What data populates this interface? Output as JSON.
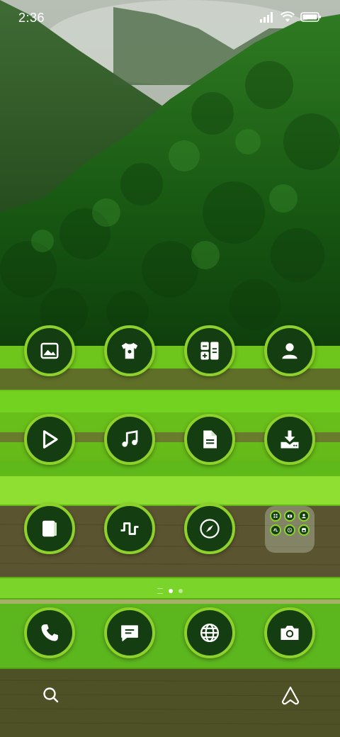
{
  "status_bar": {
    "time": "2:36",
    "icons": [
      "signal-icon",
      "wifi-icon",
      "battery-icon"
    ]
  },
  "home_apps": [
    {
      "icon": "gallery-icon"
    },
    {
      "icon": "themes-icon"
    },
    {
      "icon": "calculator-icon"
    },
    {
      "icon": "contacts-icon"
    },
    {
      "icon": "video-player-icon"
    },
    {
      "icon": "music-icon"
    },
    {
      "icon": "notes-icon"
    },
    {
      "icon": "downloads-icon"
    },
    {
      "icon": "files-icon"
    },
    {
      "icon": "activity-icon"
    },
    {
      "icon": "compass-icon"
    }
  ],
  "folder_apps": [
    "grid-icon",
    "camera-icon",
    "user-icon",
    "activity-icon",
    "phone-icon",
    "save-icon"
  ],
  "pager": {
    "pages": 2,
    "current": 0
  },
  "dock": [
    {
      "icon": "phone-icon"
    },
    {
      "icon": "messages-icon"
    },
    {
      "icon": "browser-icon"
    },
    {
      "icon": "camera-icon"
    }
  ],
  "bottom_bar": [
    "search-icon",
    "assistant-icon"
  ],
  "colors": {
    "icon_bg": "#143d12",
    "icon_ring": "#8ed12a",
    "icon_glyph": "#ffffff"
  }
}
